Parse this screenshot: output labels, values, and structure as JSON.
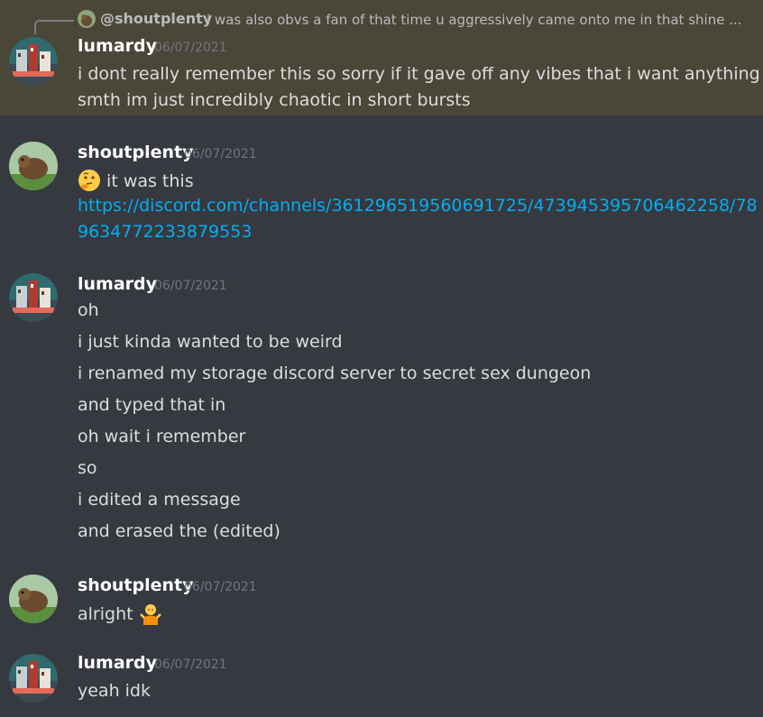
{
  "reply": {
    "author": "@shoutplenty",
    "text": "i was also obvs a fan of that time u aggressively came onto me in that shine ..."
  },
  "messages": [
    {
      "author": "lumardy",
      "timestamp": "06/07/2021",
      "lines": [
        "i dont really remember this so sorry if it gave off any vibes that i want anything or",
        "smth im just incredibly chaotic in short bursts"
      ]
    },
    {
      "author": "shoutplenty",
      "timestamp": "06/07/2021",
      "lines": [
        "it was this"
      ],
      "emoji_line0": "thinking-face",
      "link_lines": [
        "https://discord.com/channels/361296519560691725/473945395706462258/78",
        "9634772233879553"
      ]
    },
    {
      "author": "lumardy",
      "timestamp": "06/07/2021",
      "lines": [
        "oh",
        "i just kinda wanted to be weird",
        "i renamed my storage discord server to secret sex dungeon",
        "and typed that in",
        "oh wait i remember",
        "so",
        "i edited a message",
        "and erased the (edited)"
      ]
    },
    {
      "author": "shoutplenty",
      "timestamp": "06/07/2021",
      "lines": [
        "alright"
      ],
      "emoji_after": "person-shrugging"
    },
    {
      "author": "lumardy",
      "timestamp": "06/07/2021",
      "lines": [
        "yeah idk"
      ]
    }
  ],
  "colors": {
    "background": "#36393f",
    "highlight": "#4a4638",
    "link": "#00aff4",
    "text": "#dcddde",
    "timestamp": "#72767d"
  }
}
